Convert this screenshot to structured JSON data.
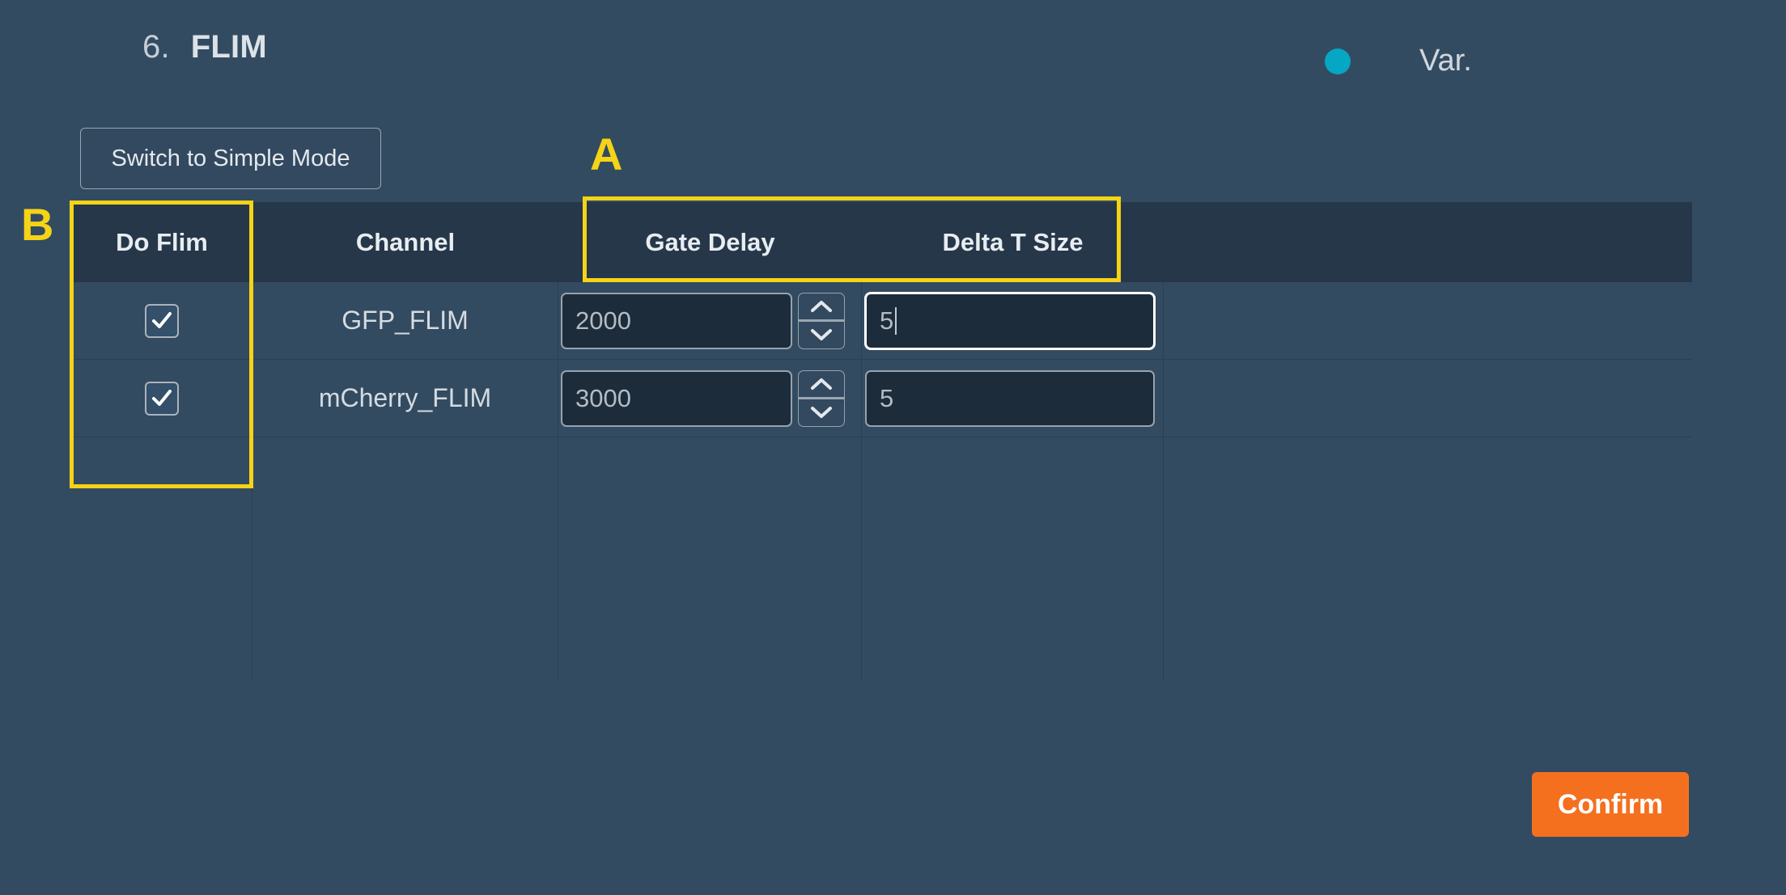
{
  "header": {
    "step_number": "6.",
    "title": "FLIM",
    "status_dot_color": "#06a7c4",
    "status_label": "Var."
  },
  "toolbar": {
    "switch_mode_label": "Switch to Simple Mode"
  },
  "table": {
    "columns": [
      {
        "key": "do_flim",
        "label": "Do Flim"
      },
      {
        "key": "channel",
        "label": "Channel"
      },
      {
        "key": "gate_delay",
        "label": "Gate Delay"
      },
      {
        "key": "delta_t_size",
        "label": "Delta T Size"
      }
    ],
    "rows": [
      {
        "do_flim": true,
        "channel": "GFP_FLIM",
        "gate_delay": "2000",
        "delta_t_size": "5",
        "delta_focused": true
      },
      {
        "do_flim": true,
        "channel": "mCherry_FLIM",
        "gate_delay": "3000",
        "delta_t_size": "5",
        "delta_focused": false
      }
    ]
  },
  "footer": {
    "confirm_label": "Confirm",
    "confirm_color": "#f4701f"
  },
  "annotations": {
    "color": "#f5d316",
    "a": {
      "label": "A",
      "targets": "Gate Delay and Delta T Size column headers"
    },
    "b": {
      "label": "B",
      "targets": "Do Flim column"
    }
  }
}
